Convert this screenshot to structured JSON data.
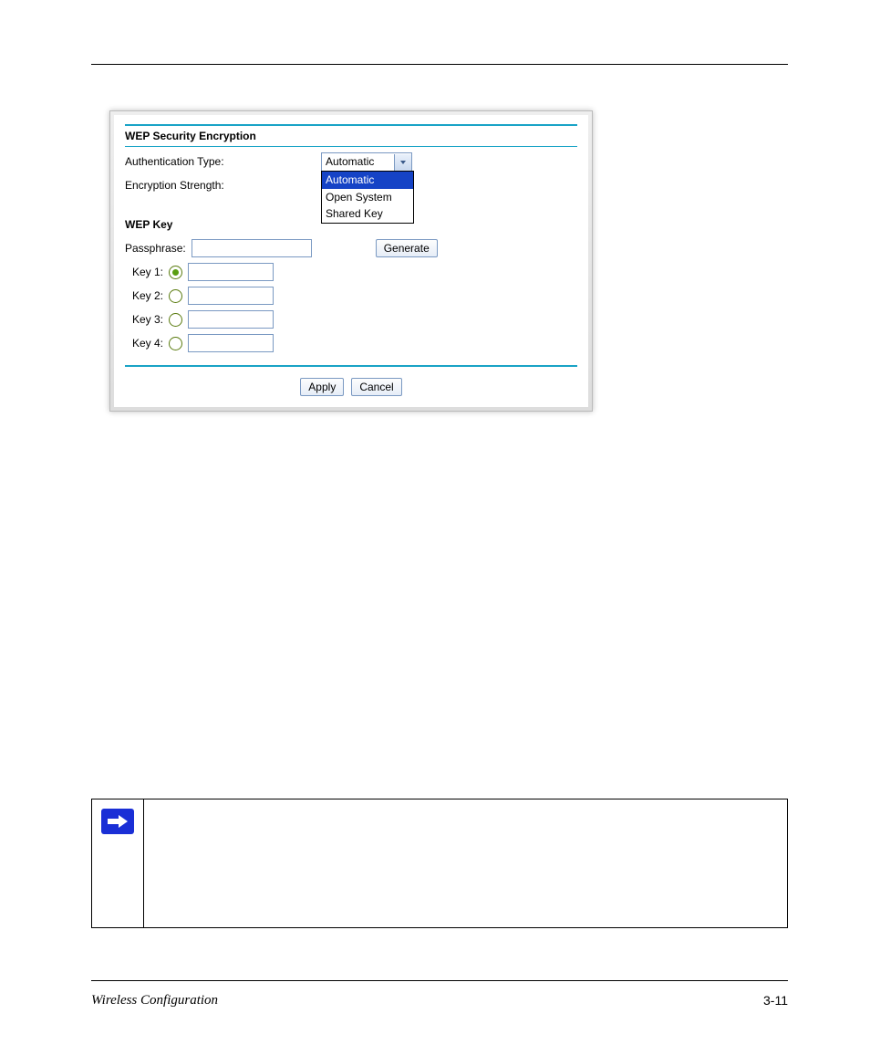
{
  "footer": {
    "section": "Wireless Configuration",
    "page": "3-11"
  },
  "panel": {
    "heading": "WEP Security Encryption",
    "auth_label": "Authentication Type:",
    "strength_label": "Encryption Strength:",
    "wep_key_heading": "WEP Key",
    "passphrase_label": "Passphrase:",
    "generate": "Generate",
    "apply": "Apply",
    "cancel": "Cancel",
    "dropdown": {
      "selected": "Automatic",
      "options": [
        "Automatic",
        "Open System",
        "Shared Key"
      ]
    },
    "keys": [
      {
        "label": "Key 1:",
        "checked": true
      },
      {
        "label": "Key 2:",
        "checked": false
      },
      {
        "label": "Key 3:",
        "checked": false
      },
      {
        "label": "Key 4:",
        "checked": false
      }
    ]
  }
}
